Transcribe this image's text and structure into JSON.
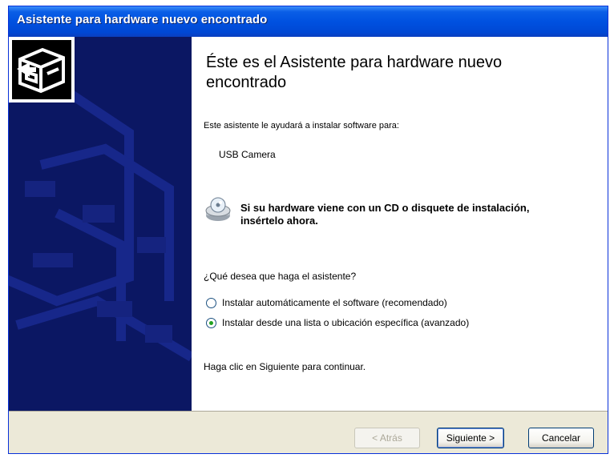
{
  "window": {
    "title": "Asistente para hardware nuevo encontrado"
  },
  "content": {
    "heading": "Éste es el Asistente para hardware nuevo encontrado",
    "intro": "Este asistente le ayudará a instalar software para:",
    "device": "USB Camera",
    "cd_prompt": "Si su hardware viene con un CD o disquete de instalación, insértelo ahora.",
    "question": "¿Qué desea que haga el asistente?",
    "options": [
      {
        "label": "Instalar automáticamente el software (recomendado)",
        "selected": false
      },
      {
        "label": "Instalar desde una lista o ubicación específica (avanzado)",
        "selected": true
      }
    ],
    "instruction": "Haga clic en Siguiente para continuar."
  },
  "buttons": {
    "back": "< Atrás",
    "next": "Siguiente >",
    "cancel": "Cancelar"
  },
  "colors": {
    "titlebar": "#0051e0",
    "sidebar": "#0b1763",
    "dialog": "#ece9d8"
  },
  "icons": {
    "hardware": "hardware-wizard-icon",
    "cd": "cd-disk-icon"
  }
}
